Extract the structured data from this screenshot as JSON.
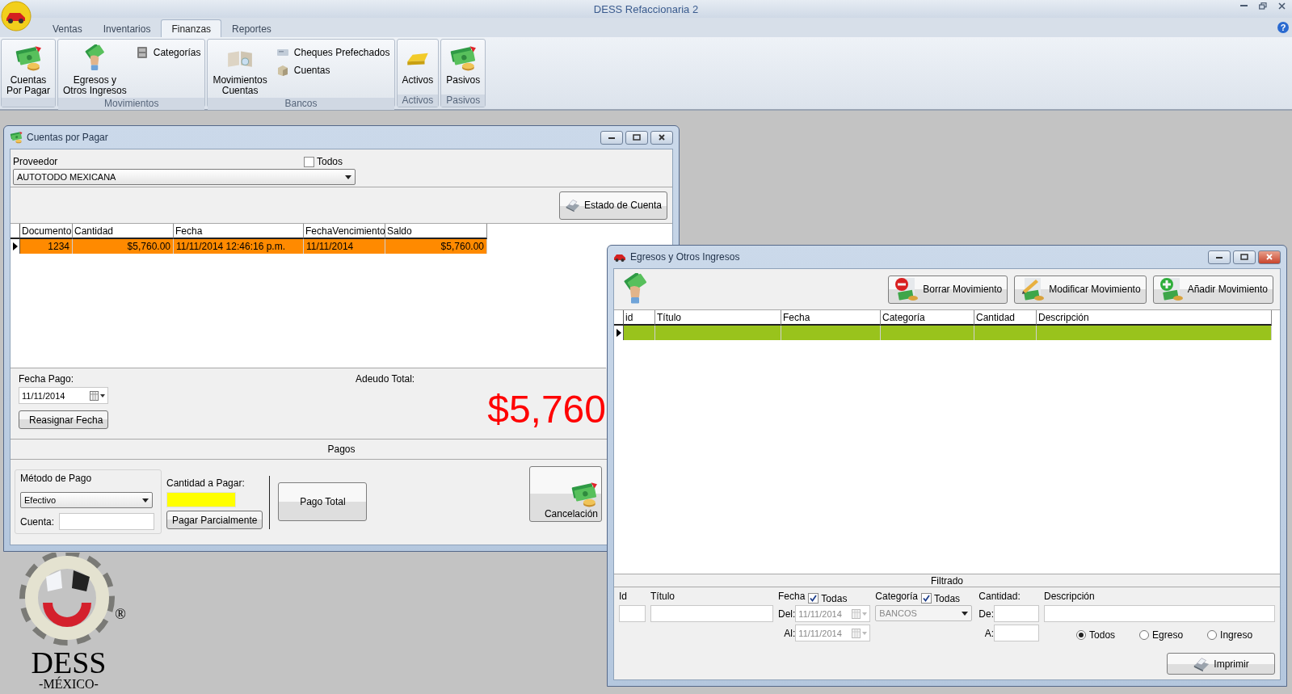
{
  "app": {
    "title": "DESS Refaccionaria 2",
    "help": "?"
  },
  "tabs": [
    {
      "label": "Ventas",
      "selected": false
    },
    {
      "label": "Inventarios",
      "selected": false
    },
    {
      "label": "Finanzas",
      "selected": true
    },
    {
      "label": "Reportes",
      "selected": false
    }
  ],
  "ribbon": [
    {
      "items": [
        {
          "kind": "large",
          "label": "Cuentas\nPor Pagar"
        }
      ]
    },
    {
      "label": "Movimientos",
      "items": [
        {
          "kind": "large",
          "label": "Egresos y\nOtros Ingresos"
        },
        {
          "kind": "small",
          "label": "Categorías"
        }
      ]
    },
    {
      "label": "Bancos",
      "items": [
        {
          "kind": "large",
          "label": "Movimientos\nCuentas"
        },
        {
          "kind": "small",
          "label": "Cheques Prefechados"
        },
        {
          "kind": "small",
          "label": "Cuentas"
        }
      ]
    },
    {
      "label": "Activos",
      "items": [
        {
          "kind": "large",
          "label": "Activos"
        }
      ]
    },
    {
      "label": "Pasivos",
      "items": [
        {
          "kind": "large",
          "label": "Pasivos"
        }
      ]
    }
  ],
  "accounts_window": {
    "title": "Cuentas por Pagar",
    "supplier": {
      "label": "Proveedor",
      "value": "AUTOTODO MEXICANA"
    },
    "all_suppliers": {
      "label": "Todos",
      "checked": false
    },
    "statement_button": "Estado de Cuenta",
    "table": {
      "columns": [
        "Documento",
        "Cantidad",
        "Fecha",
        "FechaVencimiento",
        "Saldo"
      ],
      "rows": [
        {
          "selected": true,
          "cells": [
            "1234",
            "$5,760.00",
            "11/11/2014 12:46:16 p.m.",
            "11/11/2014",
            "$5,760.00"
          ]
        }
      ]
    },
    "payment_date": {
      "label": "Fecha Pago:",
      "value": "11/11/2014"
    },
    "reassign_button": "Reasignar Fecha",
    "debt": {
      "label": "Adeudo Total:",
      "amount": "$5,760"
    },
    "payments": {
      "title": "Pagos",
      "method": {
        "title": "Método de Pago",
        "value": "Efectivo",
        "account_label": "Cuenta:"
      },
      "amount_label": "Cantidad a Pagar:",
      "partial_button": "Pagar Parcialmente",
      "total_button": "Pago Total",
      "cancel_button": "Cancelación"
    }
  },
  "movements_window": {
    "title": "Egresos y Otros Ingresos",
    "buttons": [
      "Borrar Movimiento",
      "Modificar Movimiento",
      "Añadir Movimiento"
    ],
    "table": {
      "columns": [
        "id",
        "Título",
        "Fecha",
        "Categoría",
        "Cantidad",
        "Descripción"
      ],
      "rows": [
        {
          "selected": true
        }
      ]
    },
    "filter": {
      "title": "Filtrado",
      "id_label": "Id",
      "title_label": "Título",
      "date": {
        "label": "Fecha",
        "all": {
          "label": "Todas",
          "checked": true
        },
        "from_label": "Del:",
        "from": "11/11/2014",
        "to_label": "Al:",
        "to": "11/11/2014",
        "disabled": true
      },
      "category": {
        "label": "Categoría",
        "all": {
          "label": "Todas",
          "checked": true
        },
        "value": "BANCOS",
        "disabled": true
      },
      "amount": {
        "label": "Cantidad:",
        "from_label": "De:",
        "to_label": "A:"
      },
      "description_label": "Descripción",
      "types": [
        {
          "label": "Todos",
          "selected": true
        },
        {
          "label": "Egreso",
          "selected": false
        },
        {
          "label": "Ingreso",
          "selected": false
        }
      ],
      "print_button": "Imprimir"
    }
  },
  "logo": {
    "name": "DESS",
    "subtitle": "-MÉXICO-",
    "mark": "®"
  }
}
